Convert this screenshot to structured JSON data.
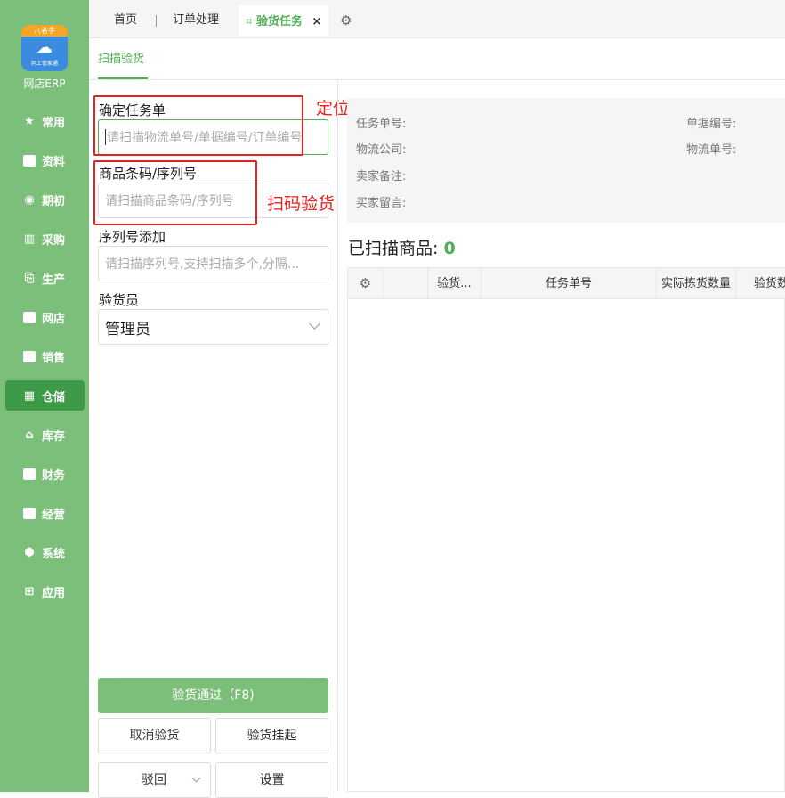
{
  "app": {
    "logo_top": "八者手",
    "logo_sub": "网上管家通",
    "name": "网店ERP"
  },
  "sidebar": {
    "items": [
      {
        "label": "常用",
        "icon": "star-icon"
      },
      {
        "label": "资料",
        "icon": "document-icon"
      },
      {
        "label": "期初",
        "icon": "clock-icon"
      },
      {
        "label": "采购",
        "icon": "purchase-icon"
      },
      {
        "label": "生产",
        "icon": "production-icon"
      },
      {
        "label": "网店",
        "icon": "store-icon"
      },
      {
        "label": "销售",
        "icon": "sales-chart-icon"
      },
      {
        "label": "仓储",
        "icon": "warehouse-icon",
        "active": true
      },
      {
        "label": "库存",
        "icon": "home-icon"
      },
      {
        "label": "财务",
        "icon": "finance-icon"
      },
      {
        "label": "经营",
        "icon": "business-icon"
      },
      {
        "label": "系统",
        "icon": "hexagon-icon"
      },
      {
        "label": "应用",
        "icon": "plus-square-icon"
      }
    ]
  },
  "tabs": {
    "home": "首页",
    "order": "订单处理",
    "inspect": "验货任务",
    "close": "×",
    "settings_icon": "gear-icon"
  },
  "subtabs": {
    "scan": "扫描验货"
  },
  "form": {
    "task_label": "确定任务单",
    "task_placeholder": "请扫描物流单号/单据编号/订单编号",
    "barcode_label": "商品条码/序列号",
    "barcode_placeholder": "请扫描商品条码/序列号",
    "serial_label": "序列号添加",
    "serial_placeholder": "请扫描序列号,支持扫描多个,分隔...",
    "inspector_label": "验货员",
    "inspector_value": "管理员"
  },
  "annotations": {
    "locate_order": "定位验货订单",
    "scan_inspect": "扫码验货"
  },
  "info": {
    "task_no": "任务单号:",
    "bill_no": "单据编号:",
    "logistics_company": "物流公司:",
    "logistics_no": "物流单号:",
    "seller_note": "卖家备注:",
    "buyer_message": "买家留言:"
  },
  "scanned": {
    "label": "已扫描商品:",
    "count": "0"
  },
  "table": {
    "columns": [
      "验货...",
      "任务单号",
      "实际拣货数量",
      "验货数"
    ]
  },
  "buttons": {
    "pass": "验货通过（F8)",
    "cancel": "取消验货",
    "hold": "验货挂起",
    "reject": "驳回",
    "settings": "设置"
  },
  "colors": {
    "sidebar": "#7cbf7a",
    "accent": "#4caf50",
    "annotation": "#e8201e"
  }
}
